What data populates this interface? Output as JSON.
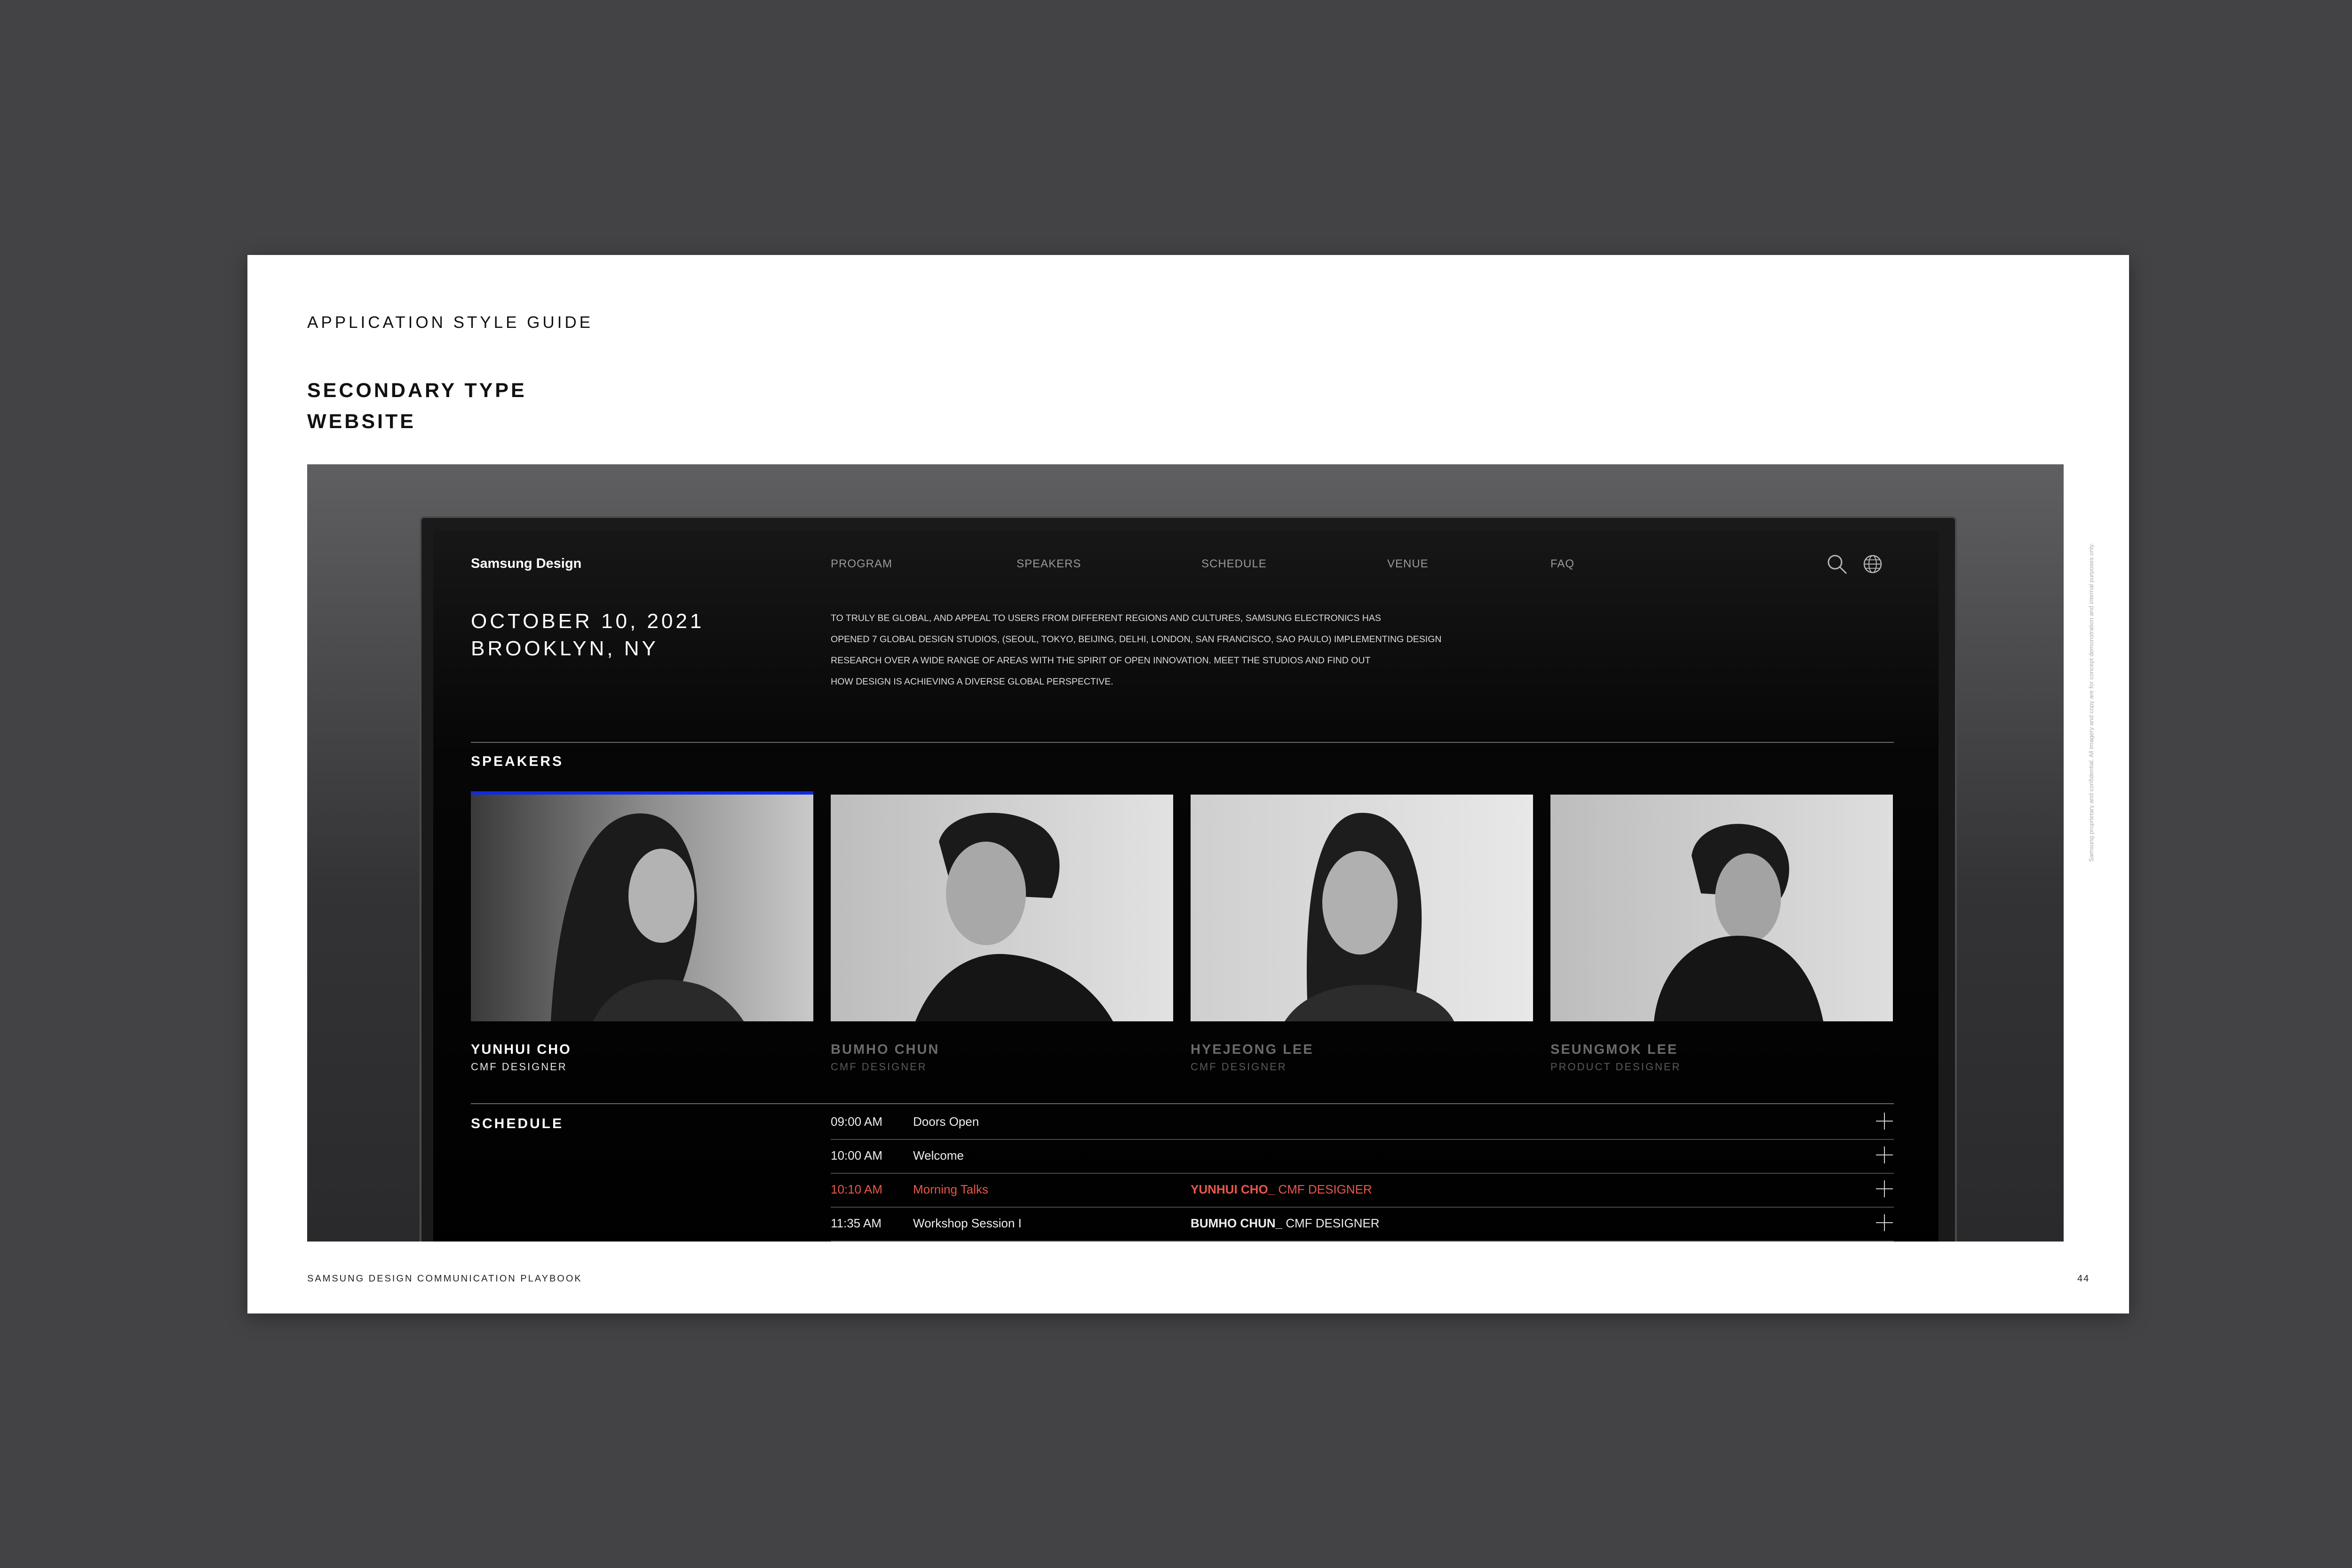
{
  "page": {
    "header_label": "APPLICATION STYLE GUIDE",
    "title_line1": "SECONDARY TYPE",
    "title_line2": "WEBSITE",
    "side_note": "Samsung proprietary and confidential. All imagery and copy are for concept demonstration and internal purposes only.",
    "footer_left": "SAMSUNG DESIGN COMMUNICATION PLAYBOOK",
    "page_number": "44"
  },
  "site": {
    "logo": "Samsung Design",
    "nav": [
      "PROGRAM",
      "SPEAKERS",
      "SCHEDULE",
      "VENUE",
      "FAQ"
    ],
    "icons": [
      "search-icon",
      "globe-icon"
    ],
    "date_line1": "OCTOBER 10, 2021",
    "date_line2": "BROOKLYN, NY",
    "intro_lines": [
      "TO TRULY BE GLOBAL, AND APPEAL TO USERS FROM DIFFERENT REGIONS AND CULTURES, SAMSUNG ELECTRONICS HAS",
      "OPENED 7 GLOBAL DESIGN STUDIOS, (SEOUL, TOKYO, BEIJING, DELHI, LONDON, SAN FRANCISCO, SAO PAULO) IMPLEMENTING DESIGN",
      "RESEARCH OVER A WIDE RANGE OF AREAS WITH THE SPIRIT OF OPEN INNOVATION. MEET THE STUDIOS AND FIND OUT",
      "HOW DESIGN IS ACHIEVING A DIVERSE GLOBAL PERSPECTIVE."
    ],
    "speakers_title": "SPEAKERS",
    "speakers": [
      {
        "name": "YUNHUI CHO",
        "role": "CMF DESIGNER",
        "active": true
      },
      {
        "name": "BUMHO CHUN",
        "role": "CMF DESIGNER",
        "active": false
      },
      {
        "name": "HYEJEONG LEE",
        "role": "CMF DESIGNER",
        "active": false
      },
      {
        "name": "SEUNGMOK LEE",
        "role": "PRODUCT DESIGNER",
        "active": false
      }
    ],
    "schedule_title": "SCHEDULE",
    "schedule": [
      {
        "time": "09:00 AM",
        "event": "Doors Open",
        "speaker": "",
        "speaker_role": "",
        "highlight": false
      },
      {
        "time": "10:00 AM",
        "event": "Welcome",
        "speaker": "",
        "speaker_role": "",
        "highlight": false
      },
      {
        "time": "10:10 AM",
        "event": "Morning Talks",
        "speaker": "YUNHUI CHO_",
        "speaker_role": " CMF DESIGNER",
        "highlight": true
      },
      {
        "time": "11:35 AM",
        "event": "Workshop Session I",
        "speaker": "BUMHO CHUN_",
        "speaker_role": " CMF DESIGNER",
        "highlight": false
      }
    ],
    "colors": {
      "accent": "#1428e0",
      "highlight": "#e7584a",
      "background": "#000000",
      "muted_text": "#9a9a9a"
    }
  }
}
